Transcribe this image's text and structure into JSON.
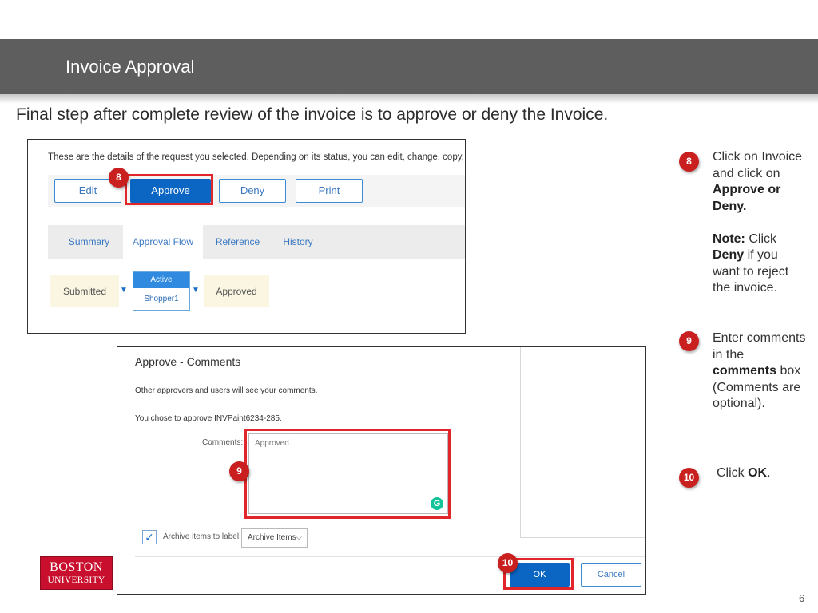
{
  "slide": {
    "title": "Invoice Approval",
    "subtitle": "Final step after complete review of the invoice is to approve or deny the Invoice.",
    "page_number": "6"
  },
  "request_screen": {
    "intro": "These are the details of the request you selected. Depending on its status, you can edit, change, copy, car",
    "buttons": {
      "edit": "Edit",
      "approve": "Approve",
      "deny": "Deny",
      "print": "Print"
    },
    "tabs": {
      "summary": "Summary",
      "approval_flow": "Approval Flow",
      "reference": "Reference",
      "history": "History"
    },
    "approval_flow": {
      "submitted": "Submitted",
      "active_header": "Active",
      "active_user": "Shopper1",
      "approved": "Approved",
      "arrow_glyph": "▼"
    }
  },
  "comments_dialog": {
    "title": "Approve - Comments",
    "visibility_note": "Other approvers and users will see your comments.",
    "approval_note": "You chose to approve INVPaint6234-285.",
    "comments_label": "Comments:",
    "comments_placeholder": "Approved.",
    "grammarly_glyph": "G",
    "archive_checkbox_glyph": "✓",
    "archive_label": "Archive items to label:",
    "archive_select_value": "Archive Items",
    "archive_chevron": "⌵",
    "ok": "OK",
    "cancel": "Cancel"
  },
  "badges": {
    "step8": "8",
    "step9": "9",
    "step10": "10"
  },
  "callouts": {
    "step8": {
      "line1": "Click on Invoice",
      "line2": "and click on",
      "bold1": "Approve or",
      "bold2": "Deny.",
      "note_label": "Note:",
      "note_click": " Click",
      "note_deny": "Deny",
      "note_rest1": " if you",
      "note_rest2": "want to reject",
      "note_rest3": "the invoice."
    },
    "step9": {
      "line1": "Enter comments",
      "line2": "in the",
      "bold": "comments",
      "line3": " box",
      "line4": "(Comments are",
      "line5": "optional)."
    },
    "step10": {
      "prefix": "Click ",
      "bold": "OK",
      "suffix": "."
    }
  },
  "logo": {
    "line1": "BOSTON",
    "line2": "UNIVERSITY"
  },
  "colors": {
    "header": "#5e5e5e",
    "highlight": "#e0262b",
    "badge": "#c9201f",
    "primary_button": "#0b66c3",
    "logo": "#c8102e"
  }
}
